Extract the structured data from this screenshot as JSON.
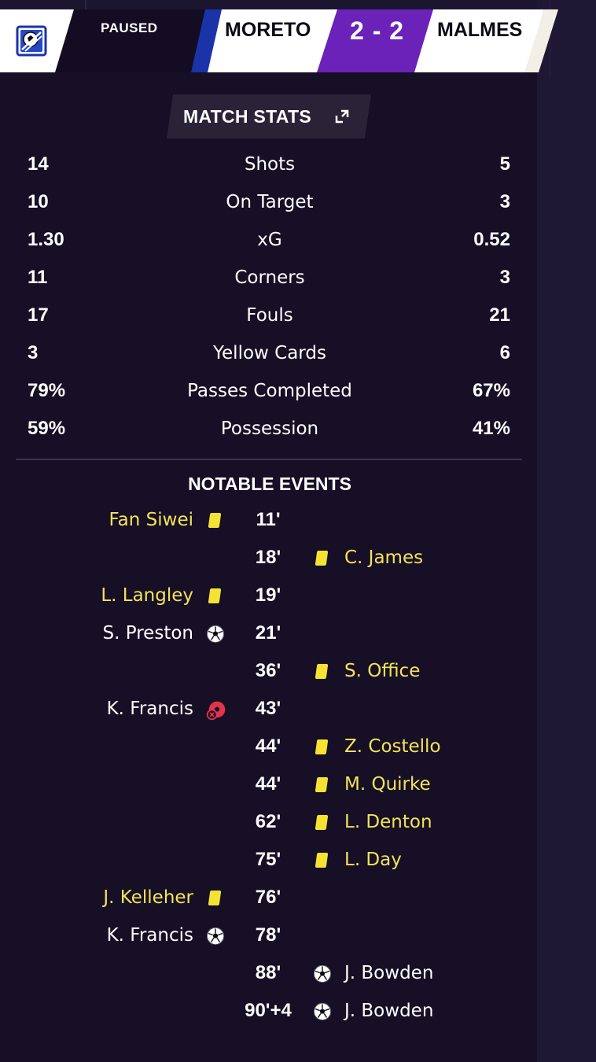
{
  "status": "PAUSED",
  "home_team": "MORETO",
  "away_team": "MALMES",
  "score": "2 - 2",
  "stats_title": "MATCH STATS",
  "stats": [
    {
      "label": "Shots",
      "home": "14",
      "away": "5"
    },
    {
      "label": "On Target",
      "home": "10",
      "away": "3"
    },
    {
      "label": "xG",
      "home": "1.30",
      "away": "0.52"
    },
    {
      "label": "Corners",
      "home": "11",
      "away": "3"
    },
    {
      "label": "Fouls",
      "home": "17",
      "away": "21"
    },
    {
      "label": "Yellow Cards",
      "home": "3",
      "away": "6"
    },
    {
      "label": "Passes Completed",
      "home": "79%",
      "away": "67%"
    },
    {
      "label": "Possession",
      "home": "59%",
      "away": "41%"
    }
  ],
  "events_title": "NOTABLE EVENTS",
  "events": [
    {
      "minute": "11'",
      "side": "home",
      "player": "Fan Siwei",
      "type": "yellow-card"
    },
    {
      "minute": "18'",
      "side": "away",
      "player": "C. James",
      "type": "yellow-card"
    },
    {
      "minute": "19'",
      "side": "home",
      "player": "L. Langley",
      "type": "yellow-card"
    },
    {
      "minute": "21'",
      "side": "home",
      "player": "S. Preston",
      "type": "goal"
    },
    {
      "minute": "36'",
      "side": "away",
      "player": "S. Office",
      "type": "yellow-card"
    },
    {
      "minute": "43'",
      "side": "home",
      "player": "K. Francis",
      "type": "missed-penalty"
    },
    {
      "minute": "44'",
      "side": "away",
      "player": "Z. Costello",
      "type": "yellow-card"
    },
    {
      "minute": "44'",
      "side": "away",
      "player": "M. Quirke",
      "type": "yellow-card"
    },
    {
      "minute": "62'",
      "side": "away",
      "player": "L. Denton",
      "type": "yellow-card"
    },
    {
      "minute": "75'",
      "side": "away",
      "player": "L. Day",
      "type": "yellow-card"
    },
    {
      "minute": "76'",
      "side": "home",
      "player": "J. Kelleher",
      "type": "yellow-card"
    },
    {
      "minute": "78'",
      "side": "home",
      "player": "K. Francis",
      "type": "goal"
    },
    {
      "minute": "88'",
      "side": "away",
      "player": "J. Bowden",
      "type": "goal"
    },
    {
      "minute": "90'+4",
      "side": "away",
      "player": "J. Bowden",
      "type": "goal"
    }
  ],
  "colors": {
    "yellow_card": "#f4e332",
    "yellow_name": "#f2e45a",
    "score_bg": "#6a22b8",
    "home_stripe": "#1a33a8",
    "missed_penalty": "#e0344a"
  },
  "icons": {
    "logo": "fm-ball-logo-icon",
    "expand": "expand-icon",
    "goal": "football-icon",
    "yellow_card": "yellow-card-icon",
    "missed_penalty": "missed-penalty-icon"
  }
}
